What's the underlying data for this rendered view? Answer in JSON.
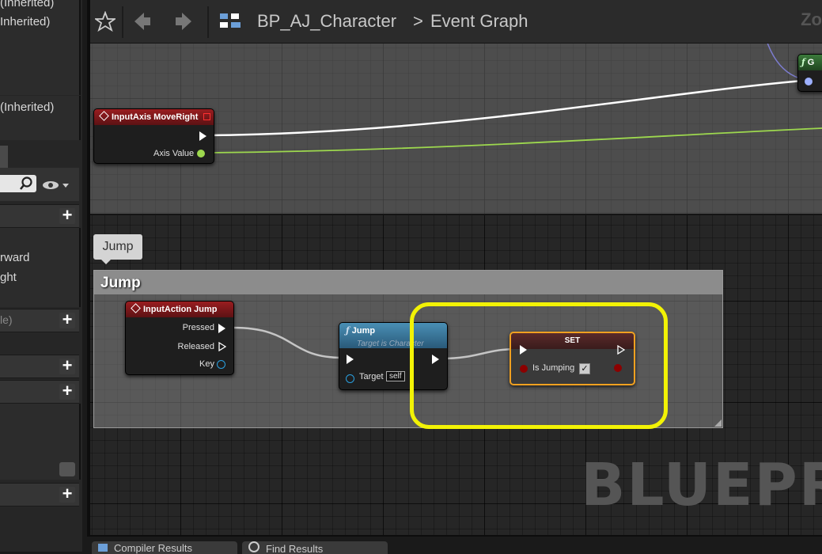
{
  "left_panel": {
    "inherited_1": "(Inherited)",
    "inherited_2": "Inherited)",
    "inherited_3": "(Inherited)",
    "item_forward": "rward",
    "item_right": "ght",
    "item_le": "le)"
  },
  "toolbar": {
    "breadcrumb_blueprint": "BP_AJ_Character",
    "breadcrumb_separator": ">",
    "breadcrumb_graph": "Event Graph",
    "zoom_label": "Zo"
  },
  "nodes": {
    "input_axis": {
      "title": "InputAxis MoveRight",
      "axis_value": "Axis Value"
    },
    "comment_tab": "Jump",
    "comment_title": "Jump",
    "input_action": {
      "title": "InputAction Jump",
      "pressed": "Pressed",
      "released": "Released",
      "key": "Key"
    },
    "jump_function": {
      "title": "Jump",
      "subtitle": "Target is Character",
      "target": "Target",
      "self": "self"
    },
    "set_node": {
      "title": "SET",
      "var": "Is Jumping"
    },
    "partial_function": {
      "title": "G"
    }
  },
  "watermark": "BLUEPRIN",
  "bottom_tabs": {
    "compiler": "Compiler Results",
    "find": "Find Results"
  },
  "colors": {
    "highlight": "#f2f205",
    "exec_wire": "#ffffff",
    "float_wire": "#9dd84e",
    "bool_pin": "#8c0000"
  }
}
